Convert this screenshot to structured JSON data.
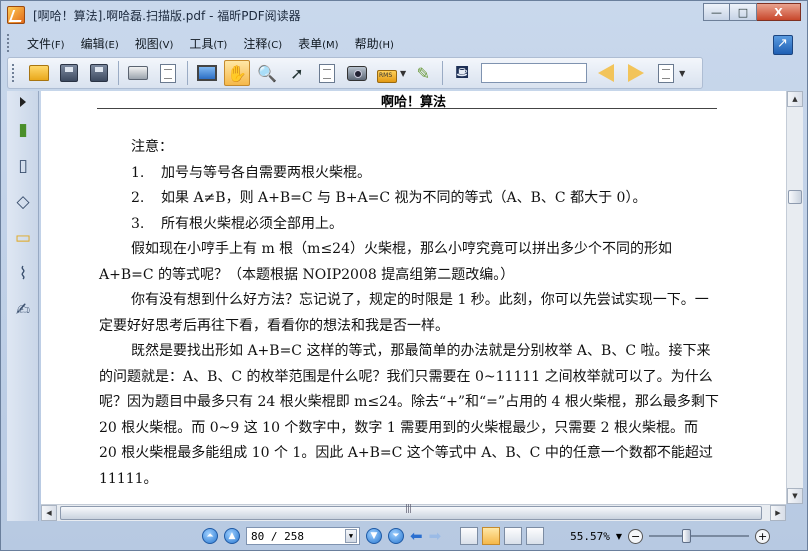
{
  "window": {
    "title": "[啊哈！算法].啊哈磊.扫描版.pdf - 福昕PDF阅读器",
    "minimize_label": "—",
    "maximize_label": "□",
    "close_label": "X"
  },
  "menu": {
    "items": [
      {
        "label": "文件",
        "key": "(F)"
      },
      {
        "label": "编辑",
        "key": "(E)"
      },
      {
        "label": "视图",
        "key": "(V)"
      },
      {
        "label": "工具",
        "key": "(T)"
      },
      {
        "label": "注释",
        "key": "(C)"
      },
      {
        "label": "表单",
        "key": "(M)"
      },
      {
        "label": "帮助",
        "key": "(H)"
      }
    ]
  },
  "toolbar": {
    "icons": [
      "open-folder-icon",
      "save-icon",
      "save-as-icon",
      "print-icon",
      "email-icon",
      "fullscreen-icon",
      "hand-tool-icon",
      "zoom-tool-icon",
      "select-arrow-icon",
      "text-select-icon",
      "snapshot-icon",
      "rms-lock-icon",
      "sign-icon",
      "find-icon",
      "prev-result-icon",
      "next-result-icon",
      "highlight-icon"
    ],
    "lock_label": "RMS",
    "search_value": ""
  },
  "document": {
    "header": "啊哈！算法",
    "note_label": "注意：",
    "list": [
      {
        "num": "1.",
        "text": "加号与等号各自需要两根火柴棍。"
      },
      {
        "num": "2.",
        "text": "如果 A≠B，则 A+B=C 与 B+A=C 视为不同的等式（A、B、C 都大于 0）。"
      },
      {
        "num": "3.",
        "text": "所有根火柴棍必须全部用上。"
      }
    ],
    "paragraphs": [
      "假如现在小哼手上有 m 根（m≤24）火柴棍，那么小哼究竟可以拼出多少个不同的形如A+B=C 的等式呢？（本题根据 NOIP2008 提高组第二题改编。）",
      "你有没有想到什么好方法？忘记说了，规定的时限是 1 秒。此刻，你可以先尝试实现一下。一定要好好思考后再往下看，看看你的想法和我是否一样。",
      "既然是要找出形如 A+B=C 这样的等式，那最简单的办法就是分别枚举 A、B、C 啦。接下来的问题就是：A、B、C 的枚举范围是什么呢？我们只需要在 0~11111 之间枚举就可以了。为什么呢？因为题目中最多只有 24 根火柴棍即 m≤24。除去“+”和“=”占用的 4 根火柴棍，那么最多剩下 20 根火柴棍。而 0~9 这 10 个数字中，数字 1 需要用到的火柴棍最少，只需要 2 根火柴棍。而 20 根火柴棍最多能组成 10 个 1。因此 A+B=C 这个等式中 A、B、C 中的任意一个数都不能超过 11111。"
    ]
  },
  "status": {
    "page_value": "80 / 258",
    "zoom_value": "55.57%",
    "zoom_out_label": "−",
    "zoom_in_label": "+",
    "zoom_slider_value": 0.36
  }
}
